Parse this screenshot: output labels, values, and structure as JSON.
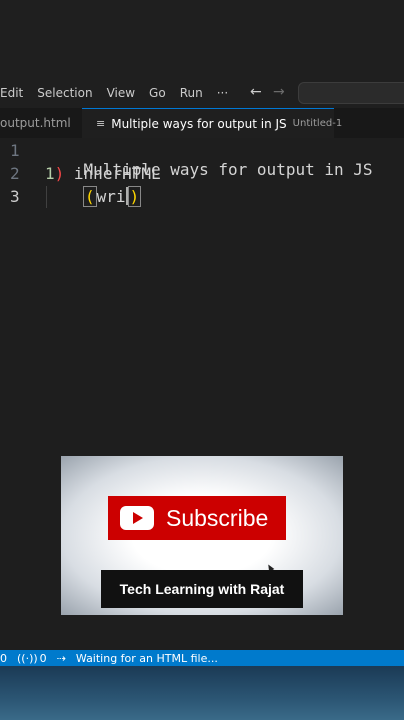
{
  "menu": {
    "items": [
      "Edit",
      "Selection",
      "View",
      "Go",
      "Run",
      "···"
    ],
    "back_glyph": "←",
    "forward_glyph": "→"
  },
  "tabs": {
    "inactive_label": "output.html",
    "active_label": "Multiple ways for output in JS",
    "active_desc": "Untitled-1"
  },
  "editor": {
    "line_numbers": [
      "1",
      "2",
      "3"
    ],
    "line1": "Multiple ways for output in JS",
    "line2_num": "1",
    "line2_paren": ")",
    "line2_text": " innerHTML",
    "line3_open": "(",
    "line3_text": "wri",
    "line3_close": ")"
  },
  "video_overlay": {
    "subscribe_label": "Subscribe",
    "channel_caption": "Tech Learning with Rajat"
  },
  "statusbar": {
    "errors": "0",
    "ports": "0",
    "message": "Waiting for an HTML file..."
  },
  "colors": {
    "status_bar": "#007acc",
    "subscribe_red": "#cc0000",
    "editor_bg": "#1e1e1e"
  }
}
